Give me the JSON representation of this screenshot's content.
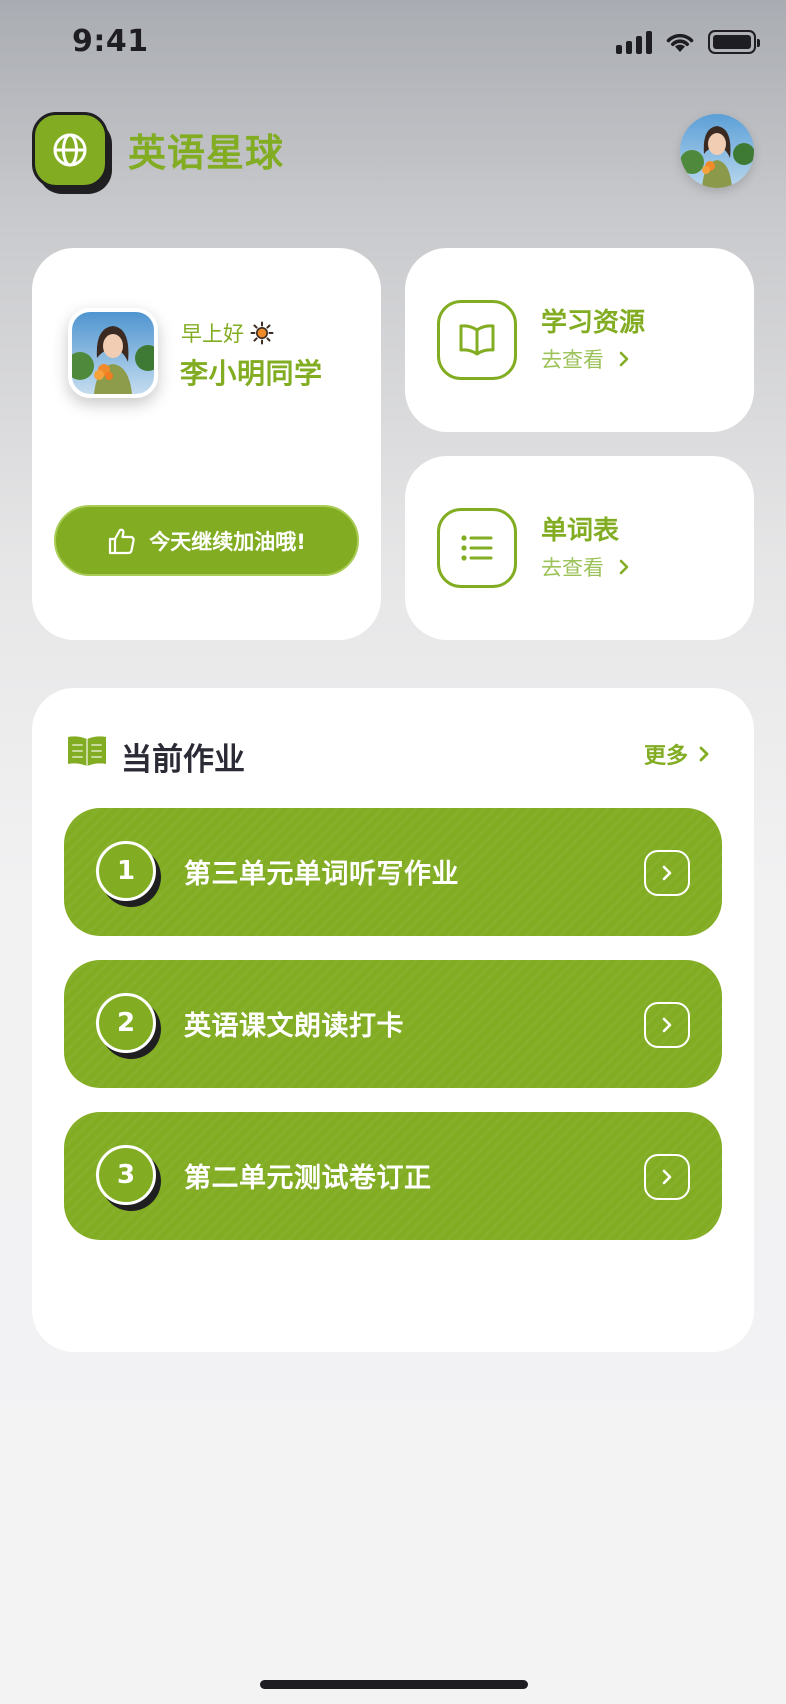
{
  "status_bar": {
    "time": "9:41"
  },
  "header": {
    "app_title": "英语星球",
    "logo_icon": "globe-icon",
    "avatar": "user-avatar"
  },
  "greeting_card": {
    "greeting": "早上好",
    "greeting_icon": "sun-icon",
    "student_name": "李小明同学",
    "cheer_button": "今天继续加油哦!"
  },
  "quick_access": [
    {
      "title": "学习资源",
      "link": "去查看",
      "icon": "book-open-icon"
    },
    {
      "title": "单词表",
      "link": "去查看",
      "icon": "list-icon"
    }
  ],
  "homework": {
    "title": "当前作业",
    "more": "更多",
    "items": [
      {
        "number": "1",
        "label": "第三单元单词听写作业"
      },
      {
        "number": "2",
        "label": "英语课文朗读打卡"
      },
      {
        "number": "3",
        "label": "第二单元测试卷订正"
      }
    ]
  },
  "colors": {
    "accent": "#82ad23",
    "dark": "#1f1f22",
    "card": "#ffffff"
  }
}
